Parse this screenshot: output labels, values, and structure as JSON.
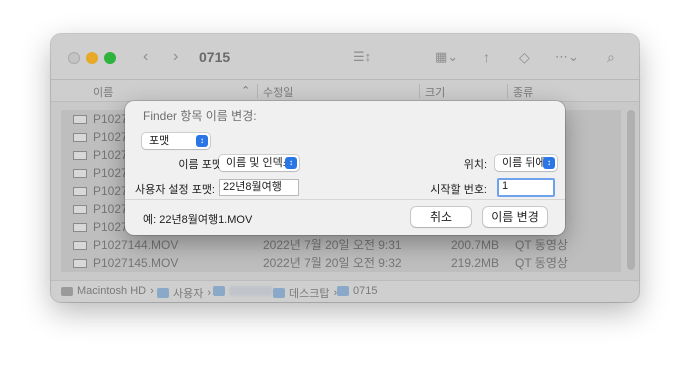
{
  "window": {
    "title": "0715",
    "columns": [
      "이름",
      "수정일",
      "크기",
      "종류"
    ],
    "files": [
      {
        "name": "P1027",
        "date": "",
        "size": "",
        "kind": ""
      },
      {
        "name": "P1027",
        "date": "",
        "size": "",
        "kind": ""
      },
      {
        "name": "P1027",
        "date": "",
        "size": "",
        "kind": ""
      },
      {
        "name": "P1027",
        "date": "",
        "size": "",
        "kind": ""
      },
      {
        "name": "P1027",
        "date": "",
        "size": "",
        "kind": ""
      },
      {
        "name": "P1027",
        "date": "",
        "size": "",
        "kind": ""
      },
      {
        "name": "P1027",
        "date": "",
        "size": "",
        "kind": ""
      },
      {
        "name": "P1027144.MOV",
        "date": "2022년 7월 20일 오전 9:31",
        "size": "200.7MB",
        "kind": "QT 동영상"
      },
      {
        "name": "P1027145.MOV",
        "date": "2022년 7월 20일 오전 9:32",
        "size": "219.2MB",
        "kind": "QT 동영상"
      }
    ],
    "path": [
      "Macintosh HD",
      "사용자",
      "",
      "데스크탑",
      "0715"
    ]
  },
  "dialog": {
    "title": "Finder 항목 이름 변경:",
    "mode": "포맷",
    "name_format_label": "이름 포맷:",
    "name_format_value": "이름 및 인덱스",
    "position_label": "위치:",
    "position_value": "이름 뒤에",
    "custom_format_label": "사용자 설정 포맷:",
    "custom_format_value": "22년8월여행",
    "start_number_label": "시작할 번호:",
    "start_number_value": "1",
    "example": "예: 22년8월여행1.MOV",
    "cancel_label": "취소",
    "rename_label": "이름 변경"
  }
}
